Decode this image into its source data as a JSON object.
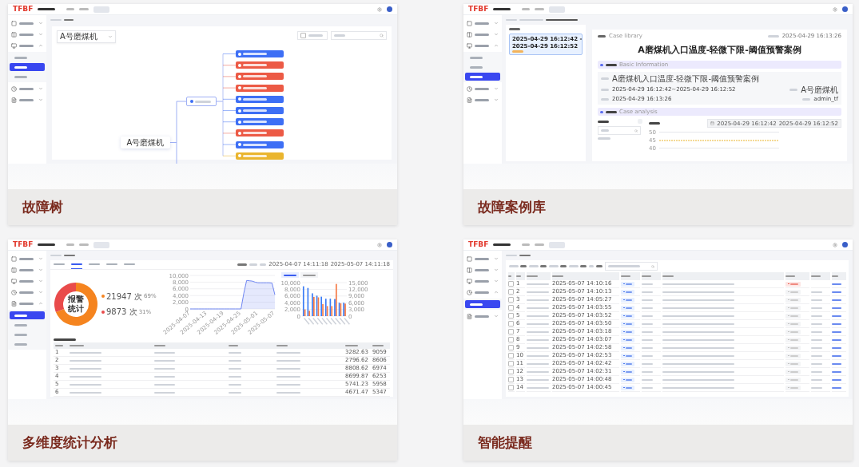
{
  "cards": [
    {
      "kind": "tree",
      "caption": "故障树",
      "logo": "TFBF",
      "sidebar": [
        {
          "expanded": false
        },
        {
          "expanded": false
        },
        {
          "expanded": true,
          "children": [
            {
              "selected": false
            },
            {
              "selected": true
            },
            {
              "selected": false
            }
          ]
        },
        {
          "expanded": false
        },
        {
          "expanded": false
        }
      ],
      "selector": "A号磨煤机",
      "show_checkbox": {
        "checked": false
      },
      "root": "A号磨煤机",
      "nodes": [
        {
          "color": "#3d6ff5"
        },
        {
          "color": "#ec5a45"
        },
        {
          "color": "#ec5a45"
        },
        {
          "color": "#ec5a45"
        },
        {
          "color": "#3d6ff5"
        },
        {
          "color": "#3d6ff5"
        },
        {
          "color": "#3d6ff5"
        },
        {
          "color": "#ec5a45"
        },
        {
          "color": "#3d6ff5"
        },
        {
          "color": "#eab52e"
        }
      ]
    },
    {
      "kind": "case",
      "caption": "故障案例库",
      "logo": "TFBF",
      "sidebar": [
        {
          "expanded": false
        },
        {
          "expanded": false
        },
        {
          "expanded": true,
          "children": [
            {
              "selected": false
            },
            {
              "selected": false
            },
            {
              "selected": true
            }
          ]
        },
        {
          "expanded": false
        },
        {
          "expanded": false
        }
      ],
      "case_item": {
        "start": "2025-04-29 16:12:42 -",
        "end": "2025-04-29 16:12:52"
      },
      "doc_header": "Case library",
      "generated": "2025-04-29 16:13:26",
      "title": "A磨煤机入口温度-轻微下限-阈值预警案例",
      "basic_section": "Basic Information",
      "info": {
        "name": "A磨煤机入口温度-轻微下限-阈值预警案例",
        "period": "2025-04-29 16:12:42~2025-04-29 16:12:52",
        "created": "2025-04-29 16:13:26",
        "node": "A号磨煤机",
        "user": "admin_tf"
      },
      "analysis_section": "Case analysis",
      "range": {
        "from": "2025-04-29 16:12:42",
        "to": "2025-04-29 16:12:52"
      },
      "ticks": [
        "50",
        "45",
        "40"
      ]
    },
    {
      "kind": "stats",
      "caption": "多维度统计分析",
      "logo": "TFBF",
      "sidebar": [
        {
          "expanded": false
        },
        {
          "expanded": false
        },
        {
          "expanded": false
        },
        {
          "expanded": false
        },
        {
          "expanded": true,
          "children": [
            {
              "selected": true
            },
            {
              "selected": false
            },
            {
              "selected": false
            },
            {
              "selected": false
            }
          ]
        }
      ],
      "tabs": [
        {
          "selected": false
        },
        {
          "selected": true
        },
        {
          "selected": false
        },
        {
          "selected": false
        },
        {
          "selected": false
        }
      ],
      "range": {
        "from": "2025-04-07 14:11:18",
        "to": "2025-05-07 14:11:18"
      },
      "donut": {
        "center": [
          "报警",
          "统计"
        ],
        "legend": [
          {
            "count": "21947 次",
            "share": "69%",
            "color": "#f5841f"
          },
          {
            "count": "9873 次",
            "share": "31%",
            "color": "#e94b4b"
          }
        ],
        "chart_data": {
          "type": "donut",
          "categories": [
            null,
            null
          ],
          "values": [
            69,
            31
          ]
        }
      },
      "line": {
        "chart_data": {
          "type": "area",
          "categories": [
            "2025-04-07",
            null,
            null,
            null,
            null,
            null,
            "2025-04-13",
            null,
            null,
            null,
            null,
            null,
            "2025-04-19",
            null,
            null,
            null,
            null,
            null,
            "2025-04-25",
            null,
            null,
            null,
            null,
            null,
            "2025-05-01",
            null,
            null,
            null,
            null,
            null,
            "2025-05-07"
          ],
          "grid": true,
          "series": [
            {
              "color": "#6f86f2",
              "values": [
                0,
                0,
                0,
                0,
                0,
                0,
                0,
                0,
                0,
                0,
                0,
                0,
                0,
                0,
                0,
                0,
                0,
                0,
                0,
                4700,
                8500,
                8400,
                8300,
                8000,
                7800,
                7800,
                7800,
                7800,
                7800,
                7700,
                4200
              ]
            }
          ],
          "ylim": [
            0,
            10000
          ],
          "yticks": [
            0,
            {
              "value": 2000,
              "label": "2,000"
            },
            {
              "value": 4000,
              "label": "4,000"
            },
            {
              "value": 6000,
              "label": "6,000"
            },
            {
              "value": 8000,
              "label": "8,000"
            },
            {
              "value": 10000,
              "label": "10,000"
            }
          ]
        }
      },
      "bar_tabs": [
        {
          "selected": true
        },
        {
          "selected": false
        }
      ],
      "bars": {
        "chart_data": {
          "type": "bar",
          "stacked": false,
          "grid": true,
          "categories": [
            null,
            null,
            null,
            null,
            null,
            null,
            null,
            null,
            null,
            null
          ],
          "series": [
            {
              "color": "#3b7cf5",
              "axis": "y",
              "values": [
                8900,
                8400,
                6800,
                6100,
                5800,
                5200,
                5200,
                5100,
                4000,
                4000
              ]
            },
            {
              "color": "#f57a45",
              "axis": "y2",
              "values": [
                3000,
                2400,
                8600,
                8400,
                5400,
                4500,
                4500,
                14400,
                5700,
                5600
              ]
            }
          ],
          "ylim": [
            0,
            10000
          ],
          "y2lim": [
            0,
            15000
          ],
          "yticks": [
            0,
            {
              "value": 2000,
              "label": "2,000"
            },
            {
              "value": 4000,
              "label": "4,000"
            },
            {
              "value": 6000,
              "label": "6,000"
            },
            {
              "value": 8000,
              "label": "8,000"
            },
            {
              "value": 10000,
              "label": "10,000"
            }
          ],
          "y2ticks": [
            0,
            {
              "value": 3000,
              "label": "3,000"
            },
            {
              "value": 6000,
              "label": "6,000"
            },
            {
              "value": 9000,
              "label": "9,000"
            },
            {
              "value": 12000,
              "label": "12,000"
            },
            {
              "value": 15000,
              "label": "15,000"
            }
          ]
        }
      },
      "rows": [
        {
          "rank": "1",
          "column_6": "3282.63",
          "column_7": "9059"
        },
        {
          "rank": "2",
          "column_6": "2796.62",
          "column_7": "8606"
        },
        {
          "rank": "3",
          "column_6": "8808.62",
          "column_7": "6974"
        },
        {
          "rank": "4",
          "column_6": "8699.87",
          "column_7": "6253"
        },
        {
          "rank": "5",
          "column_6": "5741.23",
          "column_7": "5958"
        },
        {
          "rank": "6",
          "column_6": "4671.47",
          "column_7": "5347"
        }
      ]
    },
    {
      "kind": "alerts",
      "caption": "智能提醒",
      "logo": "TFBF",
      "sidebar": [
        {
          "expanded": false
        },
        {
          "expanded": false
        },
        {
          "expanded": false
        },
        {
          "expanded": true,
          "children": [
            {
              "selected": true
            }
          ]
        },
        {
          "expanded": false
        }
      ],
      "rows": [
        {
          "no": "1",
          "time": "2025-05-07 14:10:16",
          "checked": false,
          "confirmed": false
        },
        {
          "no": "2",
          "time": "2025-05-07 14:10:13",
          "checked": false,
          "confirmed": true
        },
        {
          "no": "3",
          "time": "2025-05-07 14:05:27",
          "checked": false,
          "confirmed": true
        },
        {
          "no": "4",
          "time": "2025-05-07 14:03:55",
          "checked": false,
          "confirmed": true
        },
        {
          "no": "5",
          "time": "2025-05-07 14:03:52",
          "checked": false,
          "confirmed": true
        },
        {
          "no": "6",
          "time": "2025-05-07 14:03:50",
          "checked": false,
          "confirmed": true
        },
        {
          "no": "7",
          "time": "2025-05-07 14:03:18",
          "checked": false,
          "confirmed": true
        },
        {
          "no": "8",
          "time": "2025-05-07 14:03:07",
          "checked": false,
          "confirmed": true
        },
        {
          "no": "9",
          "time": "2025-05-07 14:02:58",
          "checked": false,
          "confirmed": true
        },
        {
          "no": "10",
          "time": "2025-05-07 14:02:53",
          "checked": false,
          "confirmed": true
        },
        {
          "no": "11",
          "time": "2025-05-07 14:02:42",
          "checked": false,
          "confirmed": true
        },
        {
          "no": "12",
          "time": "2025-05-07 14:02:31",
          "checked": false,
          "confirmed": true
        },
        {
          "no": "13",
          "time": "2025-05-07 14:00:48",
          "checked": false,
          "confirmed": true
        },
        {
          "no": "14",
          "time": "2025-05-07 14:00:45",
          "checked": false,
          "confirmed": true
        }
      ]
    }
  ]
}
